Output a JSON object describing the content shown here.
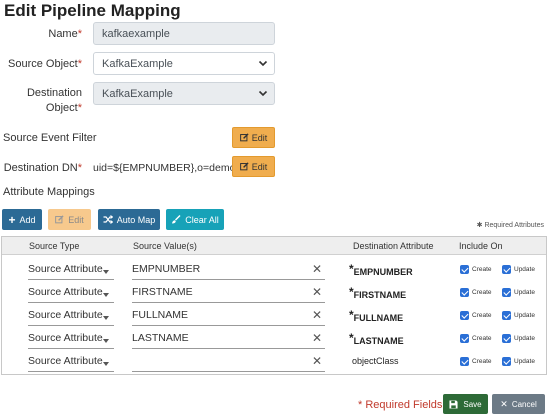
{
  "page": {
    "title": "Edit Pipeline Mapping"
  },
  "form": {
    "name_label": "Name",
    "name_value": "kafkaexample",
    "source_object_label": "Source Object",
    "source_object_value": "KafkaExample",
    "destination_object_label_1": "Destination",
    "destination_object_label_2": "Object",
    "destination_object_value": "KafkaExample",
    "required_mark": "*",
    "source_event_filter_label": "Source Event Filter",
    "destination_dn_label": "Destination DN",
    "destination_dn_value": "uid=${EMPNUMBER},o=demo",
    "edit_label": "Edit"
  },
  "attribute_mappings": {
    "section_label": "Attribute Mappings",
    "toolbar": {
      "add_label": "Add",
      "edit_label": "Edit",
      "auto_map_label": "Auto Map",
      "clear_all_label": "Clear All"
    },
    "required_note_star": "✱",
    "required_note": "Required Attributes",
    "columns": {
      "source_type": "Source Type",
      "source_values": "Source Value(s)",
      "destination_attribute": "Destination Attribute",
      "include_on": "Include On"
    },
    "create_label": "Create",
    "update_label": "Update",
    "clear_glyph": "✕",
    "star_glyph": "*",
    "rows": [
      {
        "source_type": "Source Attribute",
        "source_value": "EMPNUMBER",
        "destination": "EMPNUMBER",
        "required": true,
        "create": true,
        "update": true
      },
      {
        "source_type": "Source Attribute",
        "source_value": "FIRSTNAME",
        "destination": "FIRSTNAME",
        "required": true,
        "create": true,
        "update": true
      },
      {
        "source_type": "Source Attribute",
        "source_value": "FULLNAME",
        "destination": "FULLNAME",
        "required": true,
        "create": true,
        "update": true
      },
      {
        "source_type": "Source Attribute",
        "source_value": "LASTNAME",
        "destination": "LASTNAME",
        "required": true,
        "create": true,
        "update": true
      },
      {
        "source_type": "Source Attribute",
        "source_value": "",
        "destination": "objectClass",
        "required": false,
        "create": true,
        "update": true
      }
    ]
  },
  "footer": {
    "required_fields": "* Required Fields",
    "save_label": "Save",
    "cancel_label": "Cancel"
  },
  "colors": {
    "edit_button": "#f0ad4e",
    "primary_blue": "#2c6a95",
    "teal": "#17a2b8",
    "save_green": "#2d6a37",
    "cancel_grey": "#6c7a86",
    "required_red": "#c0392b",
    "checkbox_blue": "#2a6fd6"
  },
  "icons": {
    "edit": "pencil-square-icon",
    "add": "plus-icon",
    "auto_map": "shuffle-icon",
    "clear_all": "brush-icon",
    "save": "floppy-disk-icon",
    "cancel": "close-icon"
  }
}
